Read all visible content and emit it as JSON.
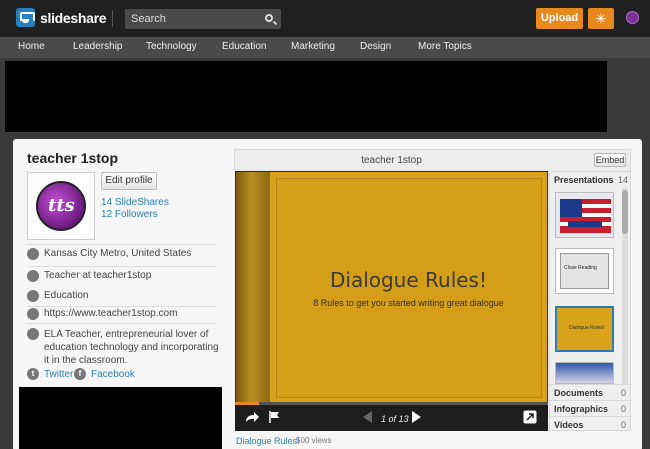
{
  "topbar": {
    "brand": "slideshare",
    "search_placeholder": "Search",
    "upload_label": "Upload"
  },
  "nav": {
    "items": [
      "Home",
      "Leadership",
      "Technology",
      "Education",
      "Marketing",
      "Design",
      "More Topics"
    ]
  },
  "profile": {
    "name": "teacher 1stop",
    "avatar_text": "tts",
    "edit_label": "Edit profile",
    "slideshares": "14 SlideShares",
    "followers": "12 Followers",
    "location": "Kansas City Metro, United States",
    "job": "Teacher at teacher1stop",
    "industry": "Education",
    "website": "https://www.teacher1stop.com",
    "bio": "ELA Teacher, entrepreneurial lover of education technology and incorporating it in the classroom.",
    "twitter": "Twitter",
    "facebook": "Facebook"
  },
  "viewer": {
    "title": "teacher 1stop",
    "embed_label": "Embed",
    "slide_title": "Dialogue Rules!",
    "slide_subtitle": "8 Rules to get you started writing great dialogue",
    "page_indicator": "1 of 13",
    "progress": 0.077
  },
  "sidebar": {
    "presentations_label": "Presentations",
    "presentations_count": "14",
    "thumb_texts": [
      "Close Reading",
      "Dialogue Rules!"
    ],
    "rows": [
      {
        "label": "Documents",
        "count": "0"
      },
      {
        "label": "Infographics",
        "count": "0"
      },
      {
        "label": "Videos",
        "count": "0"
      }
    ]
  },
  "below": {
    "title": "Dialogue Rules!",
    "views": "500 views"
  },
  "colors": {
    "accent": "#e8891e",
    "link": "#2a7fb0",
    "slide_bg": "#d8a21b"
  }
}
